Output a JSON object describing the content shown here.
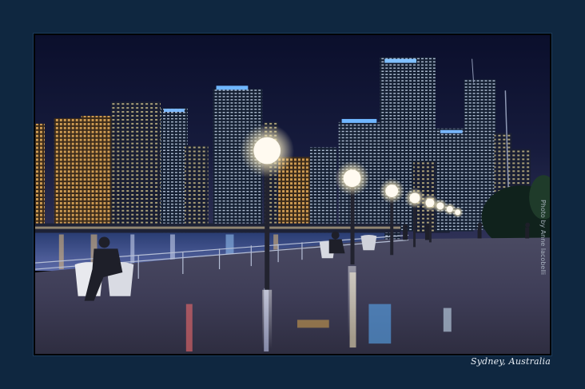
{
  "photo": {
    "subject": "Sydney city skyline at night over a wet waterfront promenade with globe street lamps",
    "credit_text": "Photo by Anne Iacobelli",
    "location_caption": "Sydney, Australia"
  },
  "colors": {
    "page_background": "#0f2740",
    "frame_border": "#000000",
    "sky_top": "#0a0f2b",
    "sky_bottom": "#2a2f52",
    "water": "#3a4f8a",
    "promenade": "#4d4c66",
    "lamp_glow": "#fff7e3"
  }
}
